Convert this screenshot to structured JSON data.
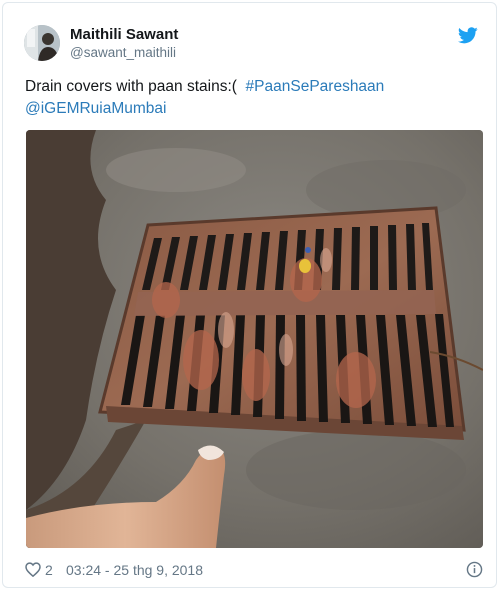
{
  "tweet": {
    "author_name": "Maithili Sawant",
    "author_handle": "@sawant_maithili",
    "text_plain": "Drain covers with paan stains:(",
    "hashtag": "#PaanSePareshaan",
    "mention": "@iGEMRuiaMumbai",
    "like_count": "2",
    "timestamp": "03:24 - 25 thg 9, 2018"
  },
  "icons": {
    "brand": "twitter-bird-icon",
    "like": "heart-icon",
    "info": "info-icon"
  },
  "colors": {
    "link": "#2b7bb9",
    "twitter_blue": "#1da1f2",
    "muted": "#657786"
  }
}
